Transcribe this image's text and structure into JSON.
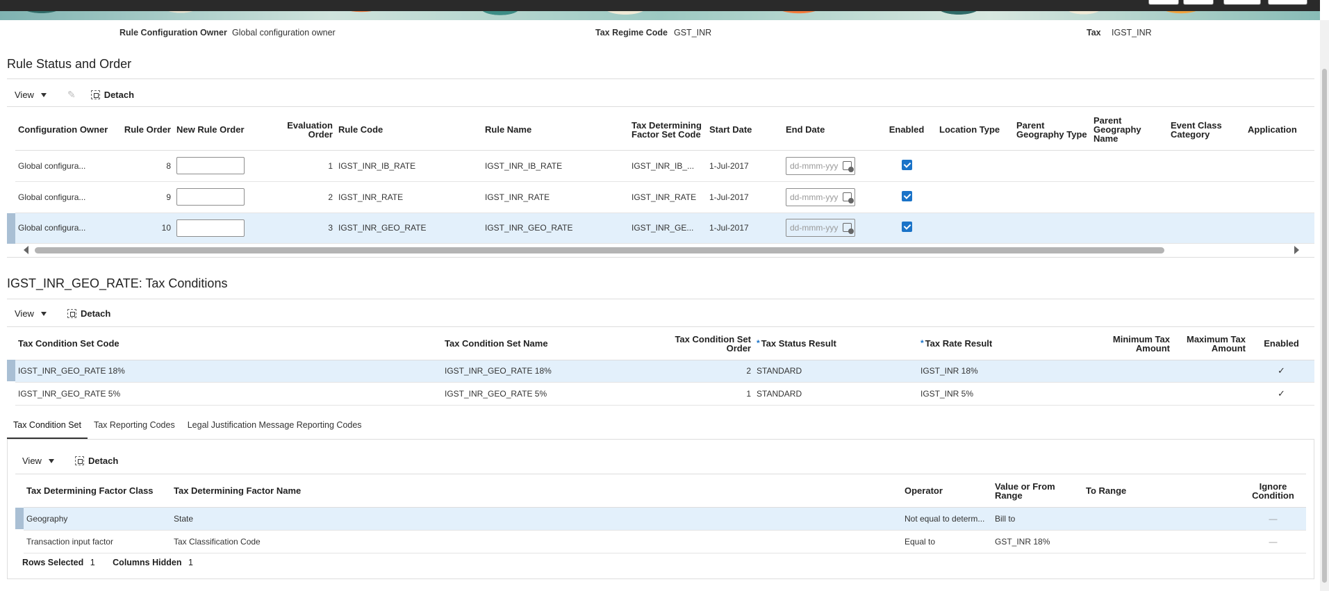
{
  "header": {
    "owner_label": "Rule Configuration Owner",
    "owner_value": "Global configuration owner",
    "regime_label": "Tax Regime Code",
    "regime_value": "GST_INR",
    "tax_label": "Tax",
    "tax_value": "IGST_INR"
  },
  "rule_section": {
    "title": "Rule Status and Order",
    "toolbar": {
      "view": "View",
      "detach": "Detach"
    },
    "columns": [
      "Configuration Owner",
      "Rule Order",
      "New Rule Order",
      "Evaluation Order",
      "Rule Code",
      "Rule Name",
      "Tax Determining Factor Set Code",
      "Start Date",
      "End Date",
      "Enabled",
      "Location Type",
      "Parent Geography Type",
      "Parent Geography Name",
      "Event Class Category",
      "Application"
    ],
    "date_placeholder": "dd-mmm-yyy",
    "rows": [
      {
        "owner": "Global configura...",
        "rule_order": "8",
        "eval_order": "1",
        "code": "IGST_INR_IB_RATE",
        "name": "IGST_INR_IB_RATE",
        "factor_set": "IGST_INR_IB_...",
        "start": "1-Jul-2017",
        "enabled": true
      },
      {
        "owner": "Global configura...",
        "rule_order": "9",
        "eval_order": "2",
        "code": "IGST_INR_RATE",
        "name": "IGST_INR_RATE",
        "factor_set": "IGST_INR_RATE",
        "start": "1-Jul-2017",
        "enabled": true
      },
      {
        "owner": "Global configura...",
        "rule_order": "10",
        "eval_order": "3",
        "code": "IGST_INR_GEO_RATE",
        "name": "IGST_INR_GEO_RATE",
        "factor_set": "IGST_INR_GE...",
        "start": "1-Jul-2017",
        "enabled": true
      }
    ]
  },
  "conditions_section": {
    "title": "IGST_INR_GEO_RATE: Tax Conditions",
    "toolbar": {
      "view": "View",
      "detach": "Detach"
    },
    "columns": [
      "Tax Condition Set Code",
      "Tax Condition Set Name",
      "Tax Condition Set Order",
      "Tax Status Result",
      "Tax Rate Result",
      "Minimum Tax Amount",
      "Maximum Tax Amount",
      "Enabled"
    ],
    "rows": [
      {
        "code": "IGST_INR_GEO_RATE 18%",
        "name": "IGST_INR_GEO_RATE 18%",
        "order": "2",
        "status": "STANDARD",
        "rate": "IGST_INR 18%",
        "enabled": "✓"
      },
      {
        "code": "IGST_INR_GEO_RATE 5%",
        "name": "IGST_INR_GEO_RATE 5%",
        "order": "1",
        "status": "STANDARD",
        "rate": "IGST_INR 5%",
        "enabled": "✓"
      }
    ]
  },
  "tabs": [
    "Tax Condition Set",
    "Tax Reporting Codes",
    "Legal Justification Message Reporting Codes"
  ],
  "condition_set": {
    "toolbar": {
      "view": "View",
      "detach": "Detach"
    },
    "columns": [
      "Tax Determining Factor Class",
      "Tax Determining Factor Name",
      "Operator",
      "Value or From Range",
      "To Range",
      "Ignore Condition"
    ],
    "rows": [
      {
        "class": "Geography",
        "name": "State",
        "operator": "Not equal to determ...",
        "value": "Bill to",
        "to": "",
        "ignore": "—"
      },
      {
        "class": "Transaction input factor",
        "name": "Tax Classification Code",
        "operator": "Equal to",
        "value": "GST_INR 18%",
        "to": "",
        "ignore": "—"
      }
    ],
    "status": {
      "rows_label": "Rows Selected",
      "rows_value": "1",
      "cols_label": "Columns Hidden",
      "cols_value": "1"
    }
  },
  "colors": {
    "selected_row": "#e3f0fb",
    "accent": "#1a73c8"
  }
}
